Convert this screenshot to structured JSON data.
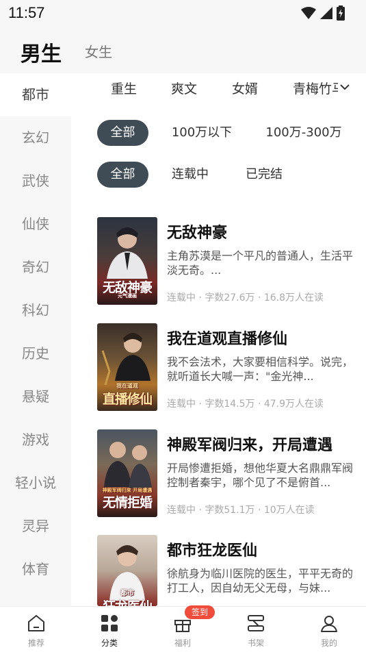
{
  "status_bar": {
    "time": "11:57"
  },
  "gender_tabs": {
    "male": "男生",
    "female": "女生"
  },
  "sidebar": {
    "items": [
      "都市",
      "玄幻",
      "武侠",
      "仙侠",
      "奇幻",
      "科幻",
      "历史",
      "悬疑",
      "游戏",
      "轻小说",
      "灵异",
      "体育"
    ],
    "active": "都市"
  },
  "subgenres": [
    "重生",
    "爽文",
    "女婿",
    "青梅竹马"
  ],
  "filters": {
    "word_count": [
      "全部",
      "100万以下",
      "100万-300万"
    ],
    "status": [
      "全部",
      "连载中",
      "已完结"
    ]
  },
  "books": [
    {
      "title": "无敌神豪",
      "desc": "主角苏漠是一个平凡的普通人，生活平淡无奇。...",
      "meta": "连载中 · 字数27.6万 · 16.8万人在读",
      "cover_text": "无敌神豪",
      "cover_sub": "元气漫画"
    },
    {
      "title": "我在道观直播修仙",
      "desc": "我不会法术，大家要相信科学。说完，就听道长大喊一声：\"金光神...",
      "meta": "连载中 · 字数14.5万 · 47.9万人在读",
      "cover_text": "直播修仙",
      "cover_sub": "我在道观"
    },
    {
      "title": "神殿军阀归来，开局遭遇",
      "desc": "开局惨遭拒婚，想他华夏大名鼎鼎军阀控制者秦宇，哪个见了不是俯首...",
      "meta": "连载中 · 字数51.1万 · 10万人在读",
      "cover_text": "无情拒婚",
      "cover_sub": "神殿军阀归来 开局遭遇"
    },
    {
      "title": "都市狂龙医仙",
      "desc": "徐航身为临川医院的医生，平平无奇的打工人，因自幼无父无母，与妹...",
      "meta": "",
      "cover_text": "狂龙医仙",
      "cover_sub": "都市"
    }
  ],
  "bottom_nav": {
    "items": [
      "推荐",
      "分类",
      "福利",
      "书架",
      "我的"
    ],
    "active": "分类",
    "badge": "签到"
  },
  "colors": {
    "chip_active": "#3f4b55",
    "badge": "#f04c3c",
    "sidebar_bg": "#f7f7f7"
  }
}
